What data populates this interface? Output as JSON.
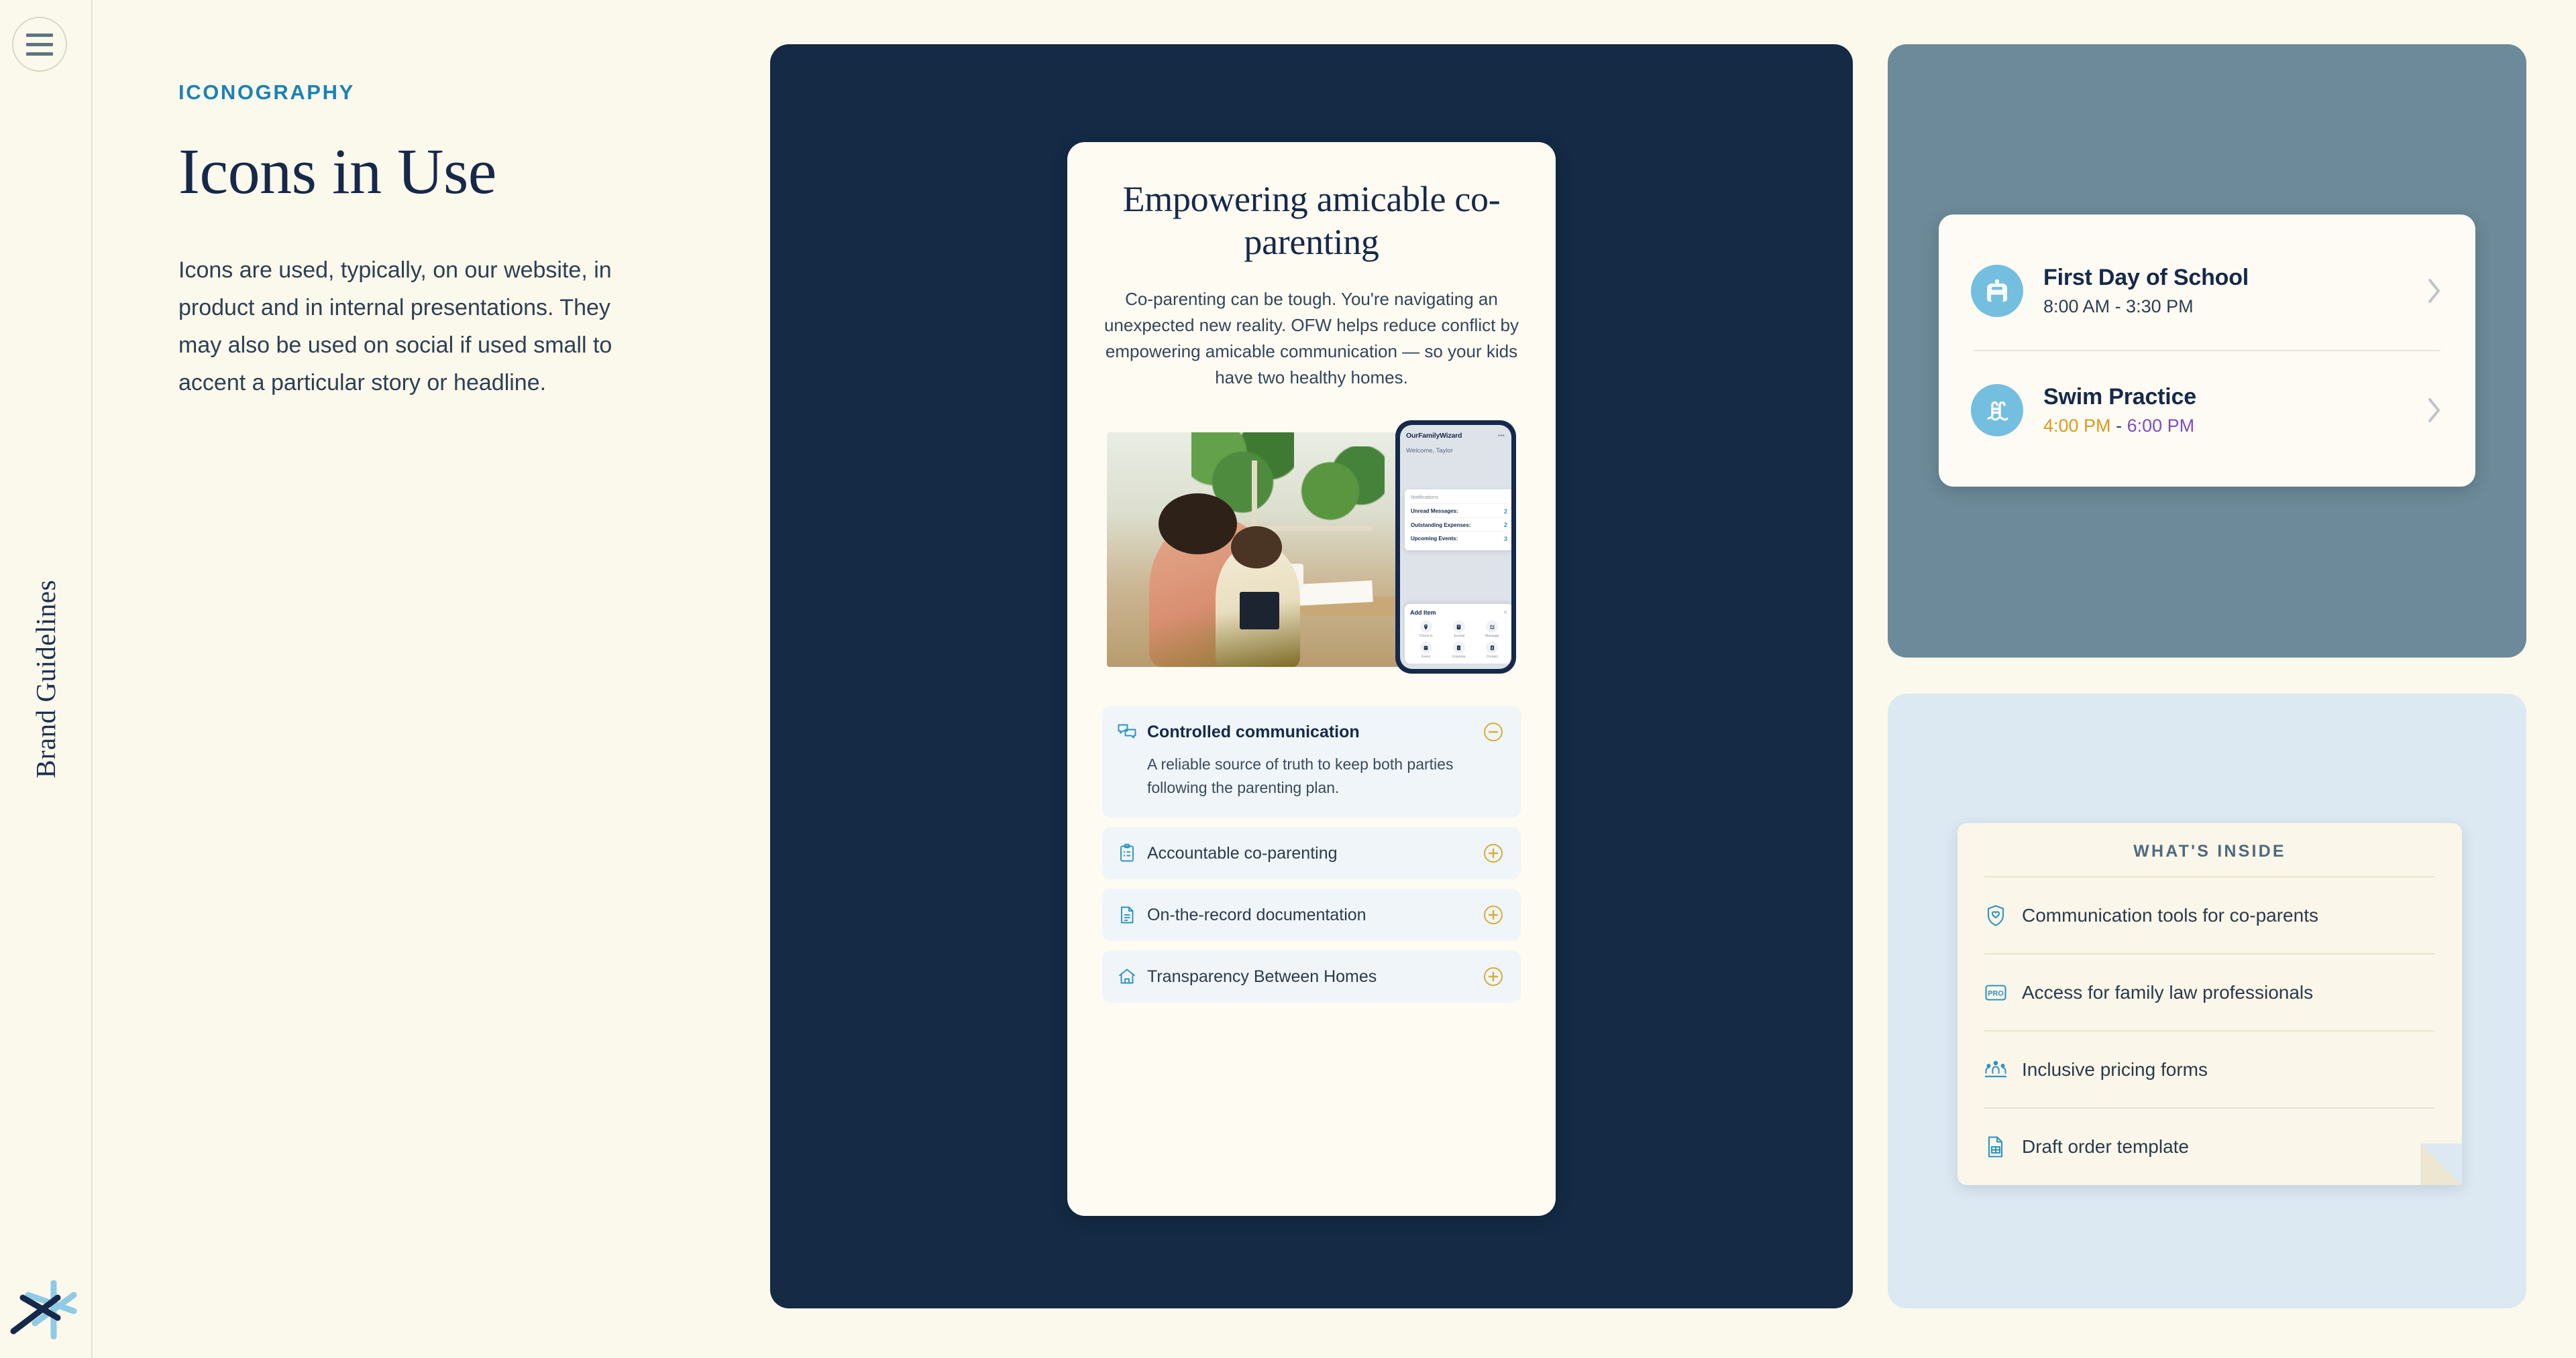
{
  "rail": {
    "menu_icon": "hamburger-menu-icon",
    "vertical_title": "Brand Guidelines",
    "logo_icon": "ofw-asterisk-logo"
  },
  "intro": {
    "eyebrow": "ICONOGRAPHY",
    "headline": "Icons in Use",
    "body": "Icons are used, typically, on our website, in product and in internal presentations. They may also be used on social if used small to accent a particular story or headline."
  },
  "phone_card": {
    "title": "Empowering amicable co-parenting",
    "subtitle": "Co-parenting can be tough. You're navigating an unexpected new reality. OFW helps reduce conflict by empowering amicable communication — so your kids have two healthy homes.",
    "mockup": {
      "brand": "OurFamilyWizard",
      "welcome": "Welcome, Taylor",
      "notifications_header": "Notifications",
      "rows": [
        {
          "label": "Unread Messages:",
          "value": "2"
        },
        {
          "label": "Outstanding Expenses:",
          "value": "2"
        },
        {
          "label": "Upcoming Events:",
          "value": "3"
        }
      ],
      "add_item_header": "Add Item",
      "add_items": [
        {
          "label": "Check In",
          "icon": "pin-icon"
        },
        {
          "label": "Journal",
          "icon": "journal-icon"
        },
        {
          "label": "Message",
          "icon": "compose-icon"
        },
        {
          "label": "Event",
          "icon": "calendar-icon"
        },
        {
          "label": "Expense",
          "icon": "expense-icon"
        },
        {
          "label": "Contact",
          "icon": "contact-icon"
        }
      ]
    },
    "accordion": [
      {
        "label": "Controlled communication",
        "icon": "chat-bubbles-icon",
        "toggle": "minus-circle-icon",
        "open": true,
        "body": "A reliable source of truth to keep both parties following the parenting plan."
      },
      {
        "label": "Accountable co-parenting",
        "icon": "clipboard-checklist-icon",
        "toggle": "plus-circle-icon",
        "open": false,
        "body": ""
      },
      {
        "label": "On-the-record documentation",
        "icon": "document-icon",
        "toggle": "plus-circle-icon",
        "open": false,
        "body": ""
      },
      {
        "label": "Transparency Between Homes",
        "icon": "home-icon",
        "toggle": "plus-circle-icon",
        "open": false,
        "body": ""
      }
    ]
  },
  "events_card": {
    "items": [
      {
        "title": "First Day of School",
        "time": "8:00 AM - 3:30 PM",
        "time_start": "",
        "time_end": "",
        "icon": "backpack-icon",
        "chevron": "chevron-right-icon",
        "colored_time": false
      },
      {
        "title": "Swim Practice",
        "time": "4:00 PM - 6:00 PM",
        "time_start": "4:00 PM",
        "time_sep": " - ",
        "time_end": "6:00 PM",
        "icon": "pool-ladder-icon",
        "chevron": "chevron-right-icon",
        "colored_time": true
      }
    ]
  },
  "inside_card": {
    "header": "WHAT'S INSIDE",
    "items": [
      {
        "label": "Communication tools for co-parents",
        "icon": "shield-heart-icon"
      },
      {
        "label": "Access for family law professionals",
        "icon": "pro-badge-icon"
      },
      {
        "label": "Inclusive pricing forms",
        "icon": "group-people-icon"
      },
      {
        "label": "Draft order template",
        "icon": "document-grid-icon"
      }
    ]
  },
  "colors": {
    "page_bg": "#FBF8EC",
    "navy": "#142A45",
    "slate": "#6C8A99",
    "pale_blue": "#DCE9F2",
    "accent_teal": "#1B82B5",
    "icon_teal": "#2D93C4",
    "gold": "#D4AF37",
    "time_start": "#D89A1E",
    "time_end": "#7C4DC4",
    "badge_blue": "#74BEE0"
  }
}
